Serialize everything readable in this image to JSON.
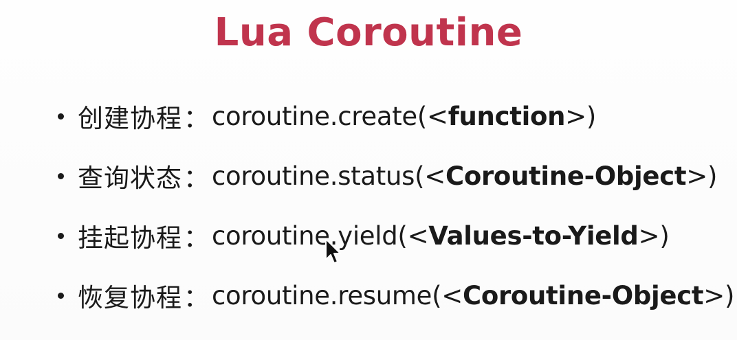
{
  "slide": {
    "title": "Lua Coroutine",
    "bullets": [
      {
        "label": "创建协程",
        "separator": "：",
        "prefix": "coroutine.create(<",
        "arg": "function",
        "suffix": ">)"
      },
      {
        "label": "查询状态",
        "separator": "：",
        "prefix": "coroutine.status(<",
        "arg": "Coroutine-Object",
        "suffix": ">)"
      },
      {
        "label": "挂起协程",
        "separator": "：",
        "prefix": "coroutine.yield(<",
        "arg": "Values-to-Yield",
        "suffix": ">)"
      },
      {
        "label": "恢复协程",
        "separator": "：",
        "prefix": "coroutine.resume(<",
        "arg": "Coroutine-Object",
        "suffix": ">)"
      }
    ]
  },
  "colors": {
    "title": "#c0344d",
    "text": "#1a1a1a",
    "background": "#ffffff"
  },
  "icons": {
    "cursor": "mouse-pointer-icon",
    "bullet": "bullet-dot-icon"
  }
}
